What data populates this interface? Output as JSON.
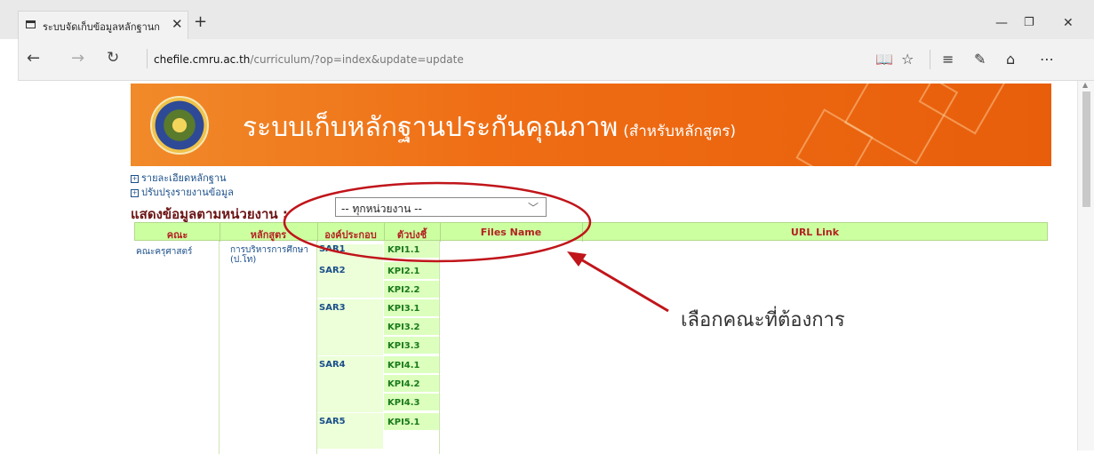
{
  "browser": {
    "tab_title": "ระบบจัดเก็บข้อมูลหลักฐานก",
    "url_host": "chefile.cmru.ac.th",
    "url_path": "/curriculum/?op=index&update=update"
  },
  "banner": {
    "title": "ระบบเก็บหลักฐานประกันคุณภาพ",
    "subtitle": "(สำหรับหลักสูตร)"
  },
  "links": [
    "รายละเอียดหลักฐาน",
    "ปรับปรุงรายงานข้อมูล"
  ],
  "filter": {
    "label": "แสดงข้อมูลตามหน่วยงาน :",
    "selected": "-- ทุกหน่วยงาน --"
  },
  "table": {
    "headers": [
      "คณะ",
      "หลักสูตร",
      "องค์ประกอบ",
      "ตัวบ่งชี้",
      "Files Name",
      "URL Link"
    ],
    "faculty": "คณะครุศาสตร์",
    "program": "การบริหารการศึกษา (ป.โท)",
    "groups": [
      {
        "sar": "SAR1",
        "kpis": [
          "KPI1.1"
        ]
      },
      {
        "sar": "SAR2",
        "kpis": [
          "KPI2.1",
          "KPI2.2"
        ]
      },
      {
        "sar": "SAR3",
        "kpis": [
          "KPI3.1",
          "KPI3.2",
          "KPI3.3"
        ]
      },
      {
        "sar": "SAR4",
        "kpis": [
          "KPI4.1",
          "KPI4.2",
          "KPI4.3"
        ]
      },
      {
        "sar": "SAR5",
        "kpis": [
          "KPI5.1"
        ]
      }
    ]
  },
  "annotation": {
    "text": "เลือกคณะที่ต้องการ",
    "color": "#c0151a"
  }
}
